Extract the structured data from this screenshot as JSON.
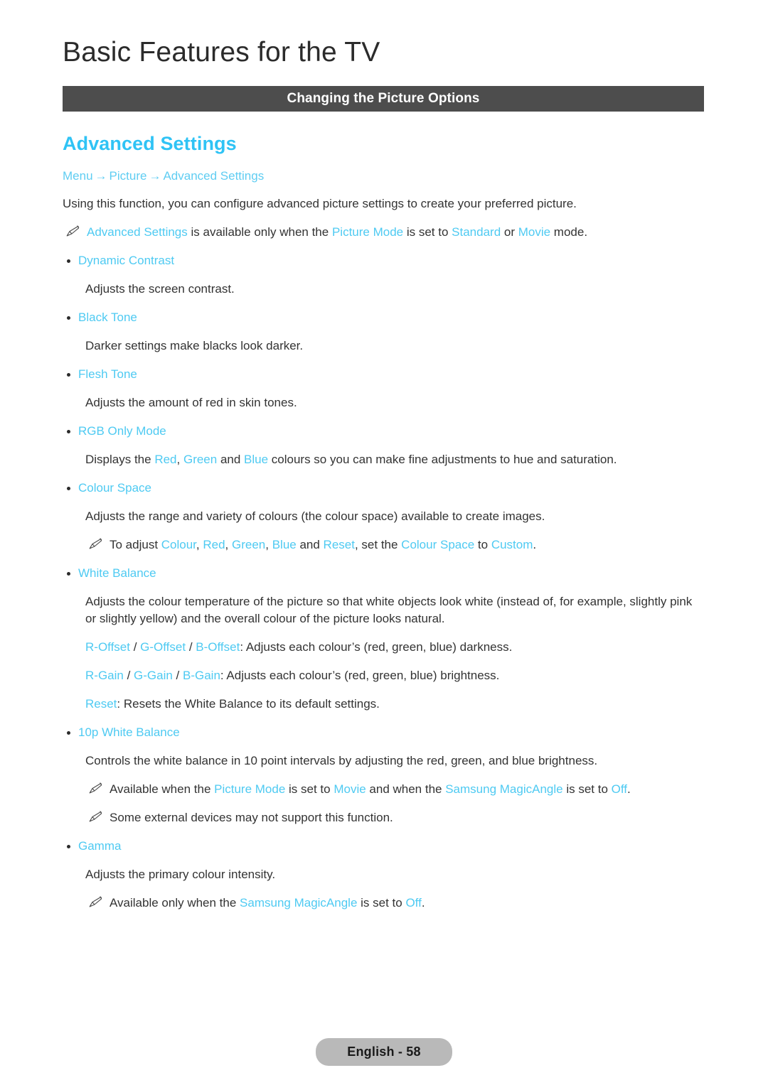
{
  "header": {
    "title": "Basic Features for the TV",
    "section_bar_label": "Changing the Picture Options"
  },
  "topic": {
    "heading": "Advanced Settings",
    "breadcrumb": {
      "items": [
        "Menu",
        "Picture",
        "Advanced Settings"
      ],
      "separator": "→"
    },
    "intro": "Using this function, you can configure advanced picture settings to create your preferred picture."
  },
  "availability_note": {
    "icon": "pencil-note-icon",
    "seg1": "Advanced Settings",
    "seg2": " is available only when the ",
    "seg3": "Picture Mode",
    "seg4": " is set to ",
    "seg5": "Standard",
    "seg6": " or ",
    "seg7": "Movie",
    "seg8": " mode."
  },
  "items": {
    "dynamic_contrast": {
      "label": "Dynamic Contrast",
      "description": "Adjusts the screen contrast."
    },
    "black_tone": {
      "label": "Black Tone",
      "description": "Darker settings make blacks look darker."
    },
    "flesh_tone": {
      "label": "Flesh Tone",
      "description": "Adjusts the amount of red in skin tones."
    },
    "rgb_only_mode": {
      "label": "RGB Only Mode",
      "desc_a": "Displays the ",
      "desc_red": "Red",
      "desc_b": ", ",
      "desc_green": "Green",
      "desc_c": " and ",
      "desc_blue": "Blue",
      "desc_d": " colours so you can make fine adjustments to hue and saturation."
    },
    "colour_space": {
      "label": "Colour Space",
      "description": "Adjusts the range and variety of colours (the colour space) available to create images.",
      "note": {
        "icon": "pencil-note-icon",
        "t1": "To adjust ",
        "t_colour": "Colour",
        "t2": ", ",
        "t_red": "Red",
        "t3": ", ",
        "t_green": "Green",
        "t4": ", ",
        "t_blue": "Blue",
        "t5": " and ",
        "t_reset": "Reset",
        "t6": ", set the ",
        "t_colour_space": "Colour Space",
        "t7": " to ",
        "t_custom": "Custom",
        "t8": "."
      }
    },
    "white_balance": {
      "label": "White Balance",
      "description": "Adjusts the colour temperature of the picture so that white objects look white (instead of, for example, slightly pink or slightly yellow) and the overall colour of the picture looks natural.",
      "offset_line": {
        "r": "R-Offset",
        "sep1": " / ",
        "g": "G-Offset",
        "sep2": " / ",
        "b": "B-Offset",
        "text": ": Adjusts each colour’s (red, green, blue) darkness."
      },
      "gain_line": {
        "r": "R-Gain",
        "sep1": " / ",
        "g": "G-Gain",
        "sep2": " / ",
        "b": "B-Gain",
        "text": ": Adjusts each colour’s (red, green, blue) brightness."
      },
      "reset_line": {
        "label": "Reset",
        "text": ": Resets the White Balance to its default settings."
      }
    },
    "ten_p_white_balance": {
      "label": "10p White Balance",
      "description": "Controls the white balance in 10 point intervals by adjusting the red, green, and blue brightness.",
      "note1": {
        "icon": "pencil-note-icon",
        "t1": "Available when the ",
        "t_picture_mode": "Picture Mode",
        "t2": " is set to ",
        "t_movie": "Movie",
        "t3": " and when the ",
        "t_magic": "Samsung MagicAngle",
        "t4": " is set to ",
        "t_off": "Off",
        "t5": "."
      },
      "note2": {
        "icon": "pencil-note-icon",
        "text": "Some external devices may not support this function."
      }
    },
    "gamma": {
      "label": "Gamma",
      "description": "Adjusts the primary colour intensity.",
      "note": {
        "icon": "pencil-note-icon",
        "t1": "Available only when the ",
        "t_magic": "Samsung MagicAngle",
        "t2": " is set to ",
        "t_off": "Off",
        "t3": "."
      }
    }
  },
  "footer": {
    "page_label": "English - 58"
  },
  "colors": {
    "accent_heading": "#2fc3f5",
    "accent_link": "#4ecaf2",
    "section_bar": "#4d4d4d",
    "body_text": "#333333",
    "footer_pill": "#b9b9b9"
  }
}
